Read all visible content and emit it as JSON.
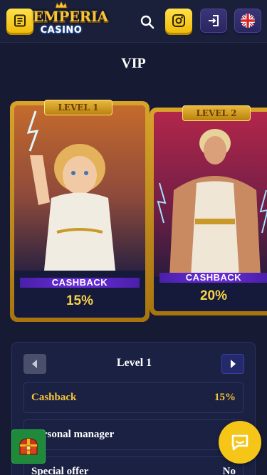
{
  "header": {
    "logo_top": "EMPERIA",
    "logo_bottom": "CASINO",
    "menu_icon": "list-icon",
    "search_icon": "search-icon",
    "profile_icon": "user-settings-icon",
    "login_icon": "login-icon",
    "language_icon": "uk-flag-icon",
    "accent_color": "#f5c518"
  },
  "page": {
    "title": "VIP"
  },
  "cards": [
    {
      "level_label": "LEVEL 1",
      "cashback_label": "CASHBACK",
      "cashback_value": "15%"
    },
    {
      "level_label": "LEVEL 2",
      "cashback_label": "CASHBACK",
      "cashback_value": "20%"
    }
  ],
  "level_panel": {
    "name": "Level 1",
    "prev_icon": "caret-left-icon",
    "next_icon": "caret-right-icon",
    "rows": [
      {
        "key": "Cashback",
        "value": "15%"
      },
      {
        "key": "Personal manager",
        "value": ""
      },
      {
        "key": "Special offer",
        "value": "No"
      }
    ]
  },
  "floating": {
    "chest_icon": "treasure-chest-icon",
    "chat_icon": "chat-icon"
  }
}
